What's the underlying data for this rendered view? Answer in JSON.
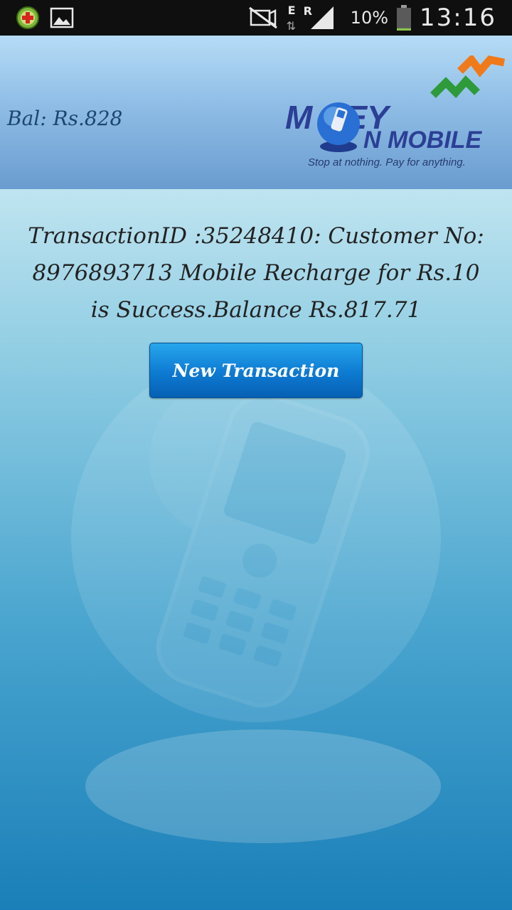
{
  "status_bar": {
    "left_icons": [
      "app-plus-icon",
      "image-icon"
    ],
    "network_type": "E",
    "roaming": "R",
    "battery_percent": "10%",
    "battery_level": 0.1,
    "time": "13:16"
  },
  "header": {
    "balance": "Bal: Rs.828",
    "logo": {
      "word_money": "M NEY",
      "word_mobile": "N MOBILE",
      "tagline": "Stop at nothing. Pay for anything."
    }
  },
  "main": {
    "message": "TransactionID :35248410: Customer No: 8976893713 Mobile Recharge for Rs.10 is Success.Balance Rs.817.71",
    "new_transaction_label": "New Transaction"
  },
  "colors": {
    "header_top": "#b6dcf6",
    "main_bottom": "#1a7fb8",
    "button": "#0d7ad2",
    "logo_blue": "#2b3f95",
    "logo_orange": "#f07a1a",
    "logo_green": "#2e9a3a"
  }
}
